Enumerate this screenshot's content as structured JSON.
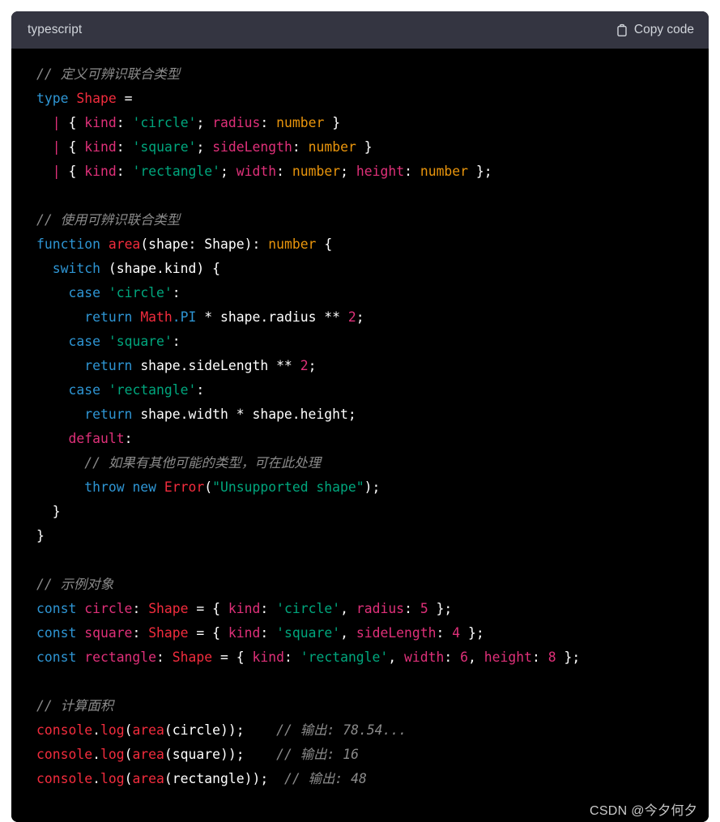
{
  "header": {
    "language": "typescript",
    "copy_label": "Copy code",
    "copy_icon": "clipboard-icon"
  },
  "theme": {
    "page_background": "#ffffff",
    "header_background": "#343541",
    "code_background": "#000000",
    "default_text": "#ffffff",
    "comment": "#8b8b8b",
    "keyword_blue": "#2e95d3",
    "keyword_pink": "#df3079",
    "type_red": "#f22c3d",
    "string_green": "#00a67d",
    "number_pink": "#df3079",
    "builtin_orange": "#e9950c"
  },
  "watermark": "CSDN @今夕何夕",
  "code": {
    "language": "typescript",
    "lines": [
      "// 定义可辨识联合类型",
      "type Shape =",
      "  | { kind: 'circle'; radius: number }",
      "  | { kind: 'square'; sideLength: number }",
      "  | { kind: 'rectangle'; width: number; height: number };",
      "",
      "// 使用可辨识联合类型",
      "function area(shape: Shape): number {",
      "  switch (shape.kind) {",
      "    case 'circle':",
      "      return Math.PI * shape.radius ** 2;",
      "    case 'square':",
      "      return shape.sideLength ** 2;",
      "    case 'rectangle':",
      "      return shape.width * shape.height;",
      "    default:",
      "      // 如果有其他可能的类型，可在此处理",
      "      throw new Error(\"Unsupported shape\");",
      "  }",
      "}",
      "",
      "// 示例对象",
      "const circle: Shape = { kind: 'circle', radius: 5 };",
      "const square: Shape = { kind: 'square', sideLength: 4 };",
      "const rectangle: Shape = { kind: 'rectangle', width: 6, height: 8 };",
      "",
      "// 计算面积",
      "console.log(area(circle));    // 输出: 78.54...",
      "console.log(area(square));    // 输出: 16",
      "console.log(area(rectangle));  // 输出: 48"
    ],
    "outputs": {
      "circle_area": "78.54...",
      "square_area": "16",
      "rectangle_area": "48"
    },
    "values": {
      "circle_radius": "5",
      "square_sideLength": "4",
      "rectangle_width": "6",
      "rectangle_height": "8"
    }
  }
}
